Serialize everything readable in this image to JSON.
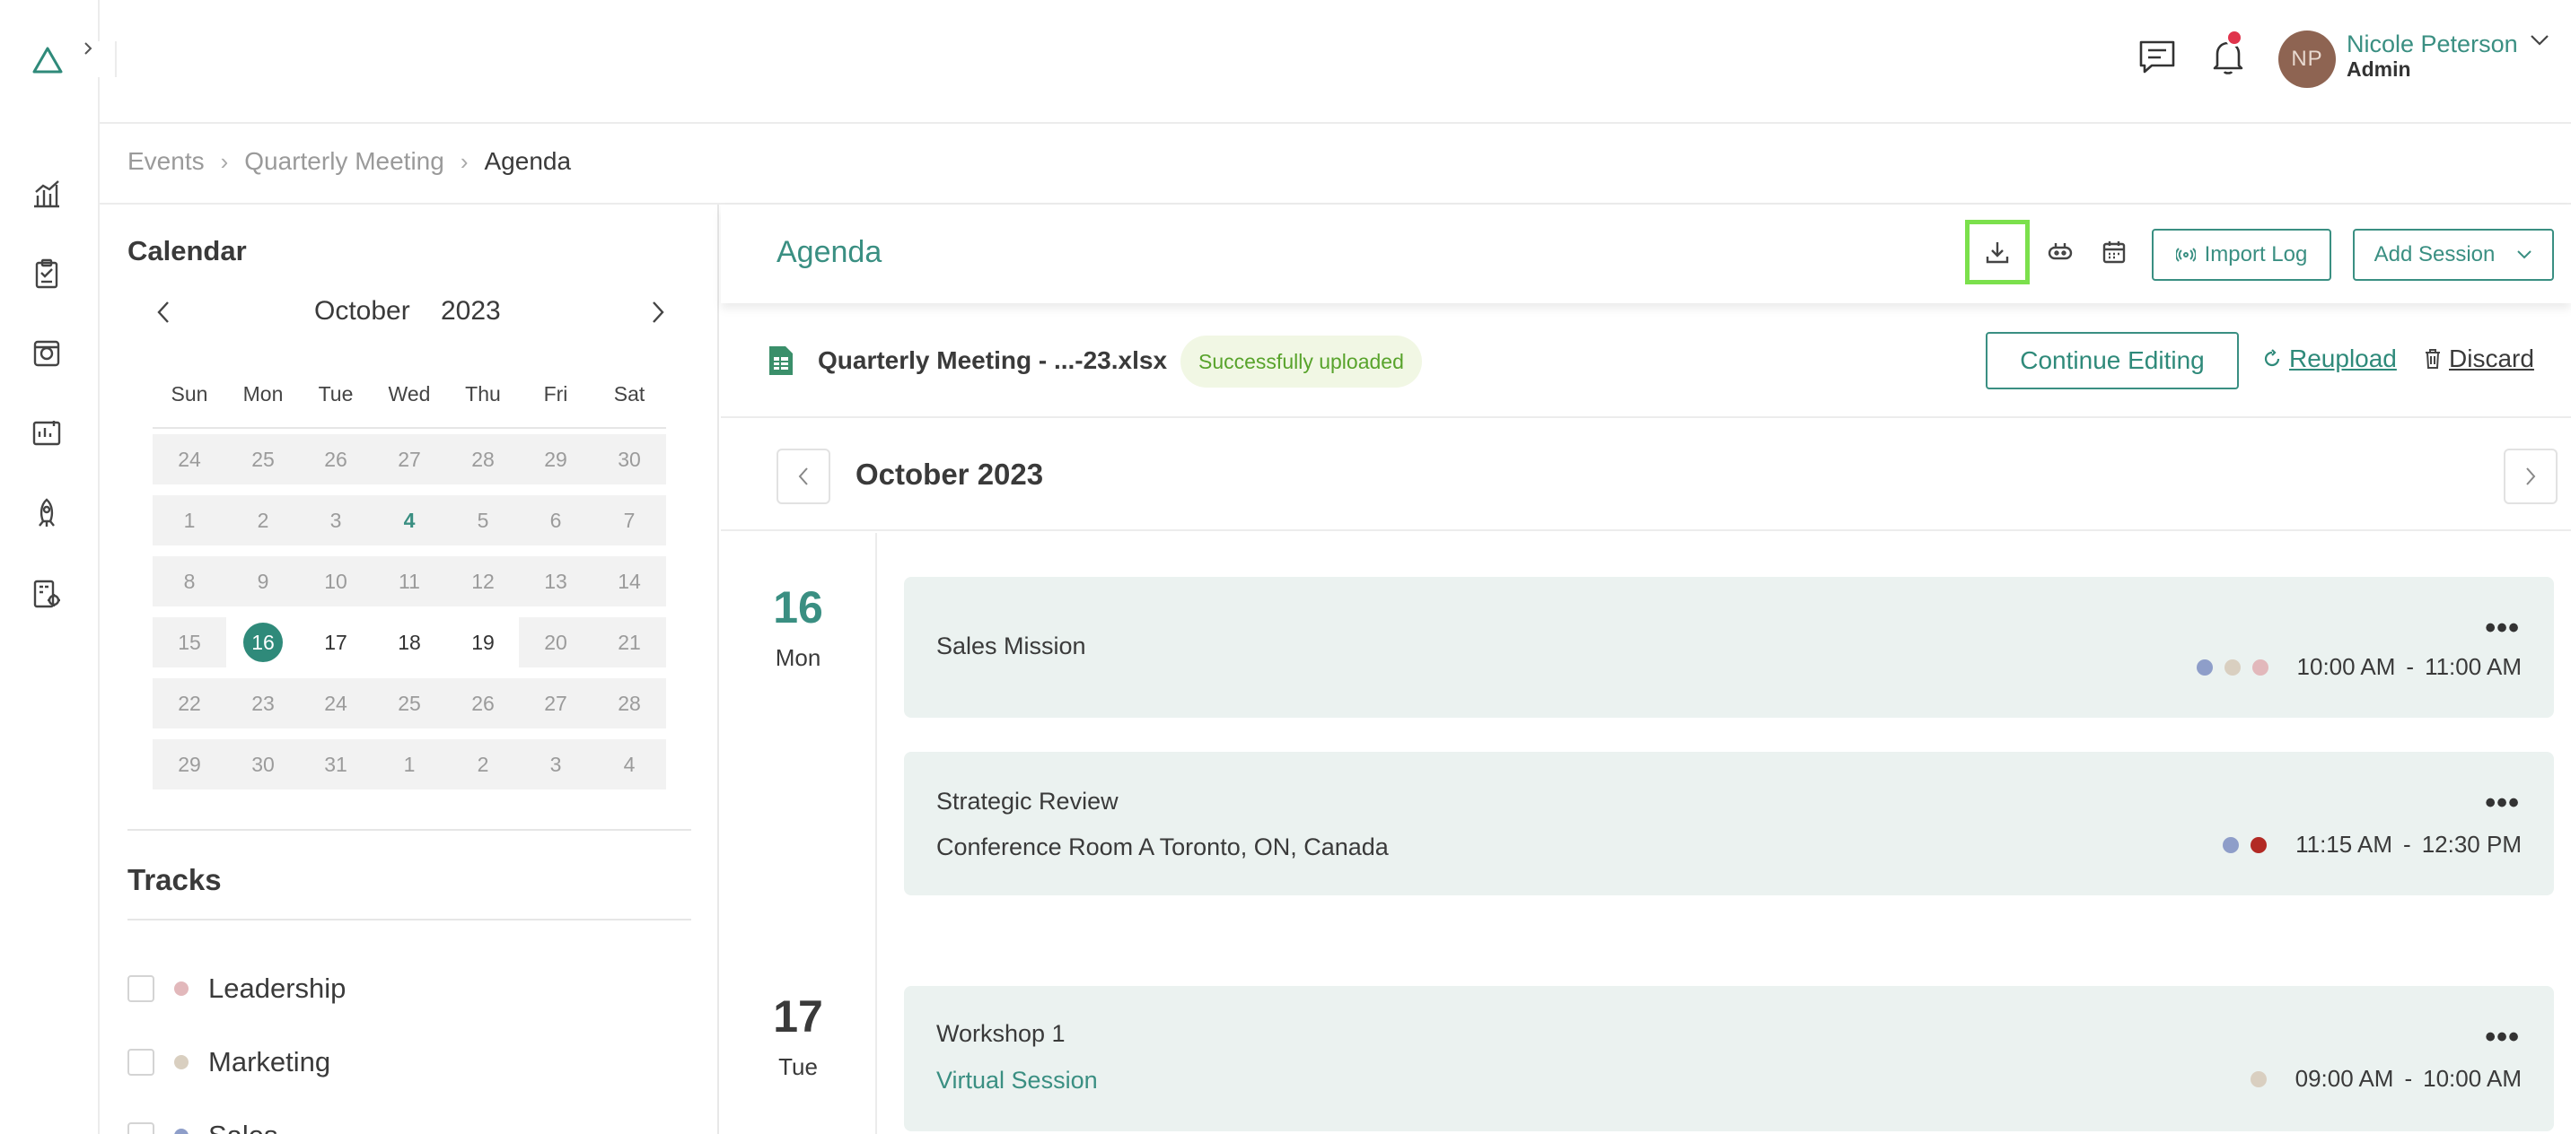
{
  "user": {
    "initials": "NP",
    "name": "Nicole Peterson",
    "role": "Admin"
  },
  "breadcrumb": [
    "Events",
    "Quarterly Meeting",
    "Agenda"
  ],
  "calendar": {
    "title": "Calendar",
    "month": "October",
    "year": "2023",
    "weekdays": [
      "Sun",
      "Mon",
      "Tue",
      "Wed",
      "Thu",
      "Fri",
      "Sat"
    ],
    "weeks": [
      [
        "24",
        "25",
        "26",
        "27",
        "28",
        "29",
        "30"
      ],
      [
        "1",
        "2",
        "3",
        "4",
        "5",
        "6",
        "7"
      ],
      [
        "8",
        "9",
        "10",
        "11",
        "12",
        "13",
        "14"
      ],
      [
        "15",
        "16",
        "17",
        "18",
        "19",
        "20",
        "21"
      ],
      [
        "22",
        "23",
        "24",
        "25",
        "26",
        "27",
        "28"
      ],
      [
        "29",
        "30",
        "31",
        "1",
        "2",
        "3",
        "4"
      ]
    ],
    "selected_day": "16"
  },
  "tracks": {
    "title": "Tracks",
    "items": [
      {
        "label": "Leadership",
        "color": "#e2b8bb"
      },
      {
        "label": "Marketing",
        "color": "#d9cfc0"
      },
      {
        "label": "Sales",
        "color": "#8e9ec9"
      }
    ]
  },
  "agenda": {
    "title": "Agenda",
    "import_log": "Import Log",
    "add_session": "Add Session"
  },
  "file": {
    "name": "Quarterly Meeting - ...-23.xlsx",
    "status": "Successfully uploaded",
    "continue_label": "Continue Editing",
    "reupload_label": "Reupload",
    "discard_label": "Discard"
  },
  "month_label": "October 2023",
  "days": [
    {
      "num": "16",
      "name": "Mon",
      "num_color": "#3a8f82",
      "sessions": [
        {
          "title": "Sales Mission",
          "subtitle": "",
          "start": "10:00 AM",
          "sep": "-",
          "end": "11:00 AM",
          "dots": [
            "#8e9ec9",
            "#d9cfc0",
            "#e2b8bb"
          ]
        },
        {
          "title": "Strategic Review",
          "subtitle": "Conference Room A Toronto, ON, Canada",
          "start": "11:15 AM",
          "sep": "-",
          "end": "12:30 PM",
          "dots": [
            "#8e9ec9",
            "#b22a24"
          ]
        }
      ]
    },
    {
      "num": "17",
      "name": "Tue",
      "num_color": "#3a3a3a",
      "sessions": [
        {
          "title": "Workshop 1",
          "subtitle": "Virtual Session",
          "start": "09:00 AM",
          "sep": "-",
          "end": "10:00 AM",
          "dots": [
            "#d9cfc0"
          ]
        }
      ]
    }
  ]
}
